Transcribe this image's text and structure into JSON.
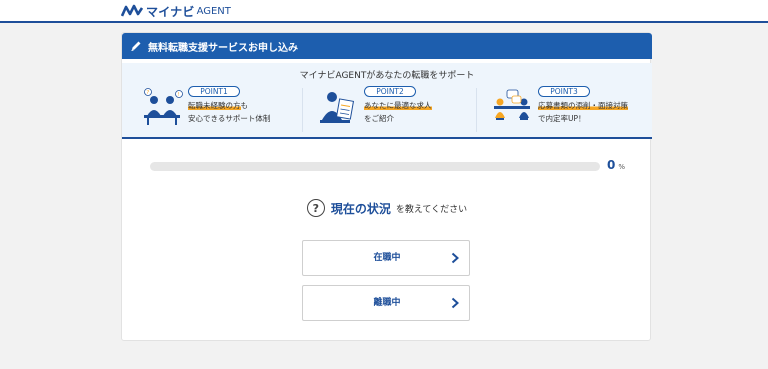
{
  "header": {
    "logo_text": "マイナビ",
    "logo_sub": "AGENT"
  },
  "banner": {
    "title": "無料転職支援サービスお申し込み",
    "icon": "pencil-icon"
  },
  "points": {
    "heading": "マイナビAGENTがあなたの転職をサポート",
    "items": [
      {
        "badge": "POINT1",
        "line1_highlight": "転職未経験の方",
        "line1_rest": "も",
        "line2": "安心できるサポート体制",
        "icon": "advisor-meeting-icon"
      },
      {
        "badge": "POINT2",
        "line1_highlight": "あなたに最適な求人",
        "line1_rest": "",
        "line2": "をご紹介",
        "icon": "advisor-document-icon"
      },
      {
        "badge": "POINT3",
        "line1_highlight": "応募書類の添削・面接対策",
        "line1_rest": "",
        "line2": "で内定率UP！",
        "icon": "interview-icon"
      }
    ]
  },
  "progress": {
    "value": "0",
    "unit": "%",
    "fraction": 0
  },
  "question": {
    "icon": "question-icon",
    "main": "現在の状況",
    "rest": "を教えてください"
  },
  "choices": [
    {
      "label": "在職中"
    },
    {
      "label": "離職中"
    }
  ],
  "colors": {
    "brand": "#1e4f9a",
    "banner": "#1d5eae",
    "highlight": "#f6a623"
  }
}
